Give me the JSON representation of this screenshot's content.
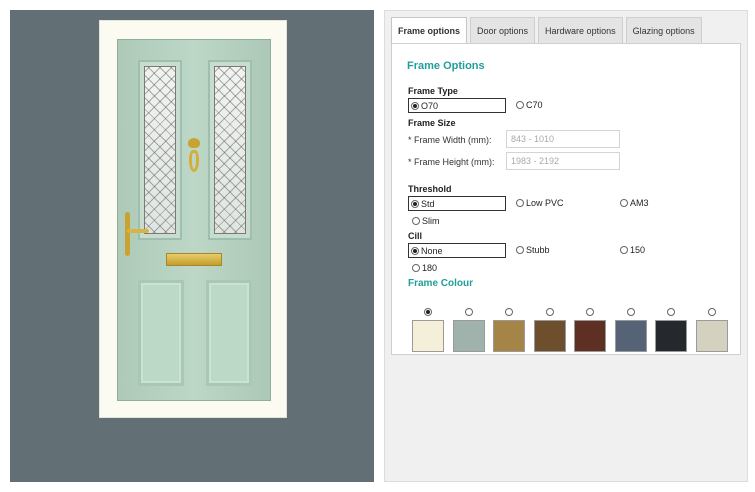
{
  "tabs": [
    {
      "label": "Frame options",
      "active": true
    },
    {
      "label": "Door options",
      "active": false
    },
    {
      "label": "Hardware options",
      "active": false
    },
    {
      "label": "Glazing options",
      "active": false
    }
  ],
  "frame_options": {
    "title": "Frame Options",
    "frame_type": {
      "label": "Frame Type",
      "options": [
        {
          "label": "O70",
          "selected": true
        },
        {
          "label": "C70",
          "selected": false
        }
      ]
    },
    "frame_size": {
      "label": "Frame Size",
      "width_label": "* Frame Width (mm):",
      "width_placeholder": "843 - 1010",
      "height_label": "* Frame Height (mm):",
      "height_placeholder": "1983 - 2192"
    },
    "threshold": {
      "label": "Threshold",
      "options": [
        {
          "label": "Std",
          "selected": true
        },
        {
          "label": "Low PVC",
          "selected": false
        },
        {
          "label": "AM3",
          "selected": false
        },
        {
          "label": "Slim",
          "selected": false
        }
      ]
    },
    "cill": {
      "label": "Cill",
      "options": [
        {
          "label": "None",
          "selected": true
        },
        {
          "label": "Stubb",
          "selected": false
        },
        {
          "label": "150",
          "selected": false
        },
        {
          "label": "180",
          "selected": false
        }
      ]
    },
    "frame_colour": {
      "label": "Frame Colour",
      "selected_index": 0,
      "swatches": [
        "#f3efd9",
        "#9fb2ac",
        "#a58447",
        "#6e4f2d",
        "#5e3024",
        "#566377",
        "#25282c",
        "#d5d1bf"
      ]
    }
  },
  "icons": {
    "radio": "radio-icon",
    "knocker": "door-knocker-icon",
    "handle": "door-handle-icon",
    "letterbox": "letterbox-icon"
  },
  "colors": {
    "accent": "#1f9f99",
    "preview_background": "#626f74",
    "door": "#b7d4c2"
  }
}
